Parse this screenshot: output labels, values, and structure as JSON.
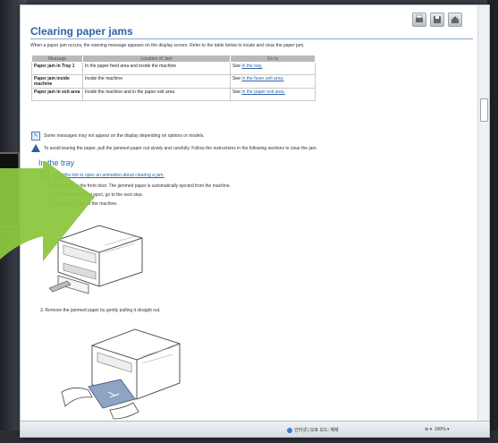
{
  "page": {
    "title": "Clearing paper jams",
    "intro": "When a paper jam occurs, the warning message appears on the display screen. Refer to the table below to locate and clear the paper jam."
  },
  "table": {
    "headers": [
      "Message",
      "Location of Jam",
      "Go to"
    ],
    "rows": [
      {
        "message": "Paper jam in Tray 1",
        "location": "In the paper feed area and inside the machine",
        "goto_prefix": "See",
        "goto_link": "In the tray."
      },
      {
        "message": "Paper jam inside machine",
        "location": "Inside the machine",
        "goto_prefix": "See",
        "goto_link": "In the fuser unit area."
      },
      {
        "message": "Paper jam in exit area",
        "location": "Inside the machine and in the paper exit area",
        "goto_prefix": "See",
        "goto_link": "In the paper exit area."
      }
    ]
  },
  "notes": {
    "note1": "Some messages may not appear on the display depending on options or models.",
    "caution": "To avoid tearing the paper, pull the jammed paper out slowly and carefully. Follow the instructions in the following sections to clear the jam."
  },
  "section": {
    "heading": "In the tray",
    "animation_link": "Click this link to open an animation about clearing a jam.",
    "step1": "Open and close the front door. The jammed paper is automatically ejected from the machine.",
    "step1b": "If the paper does not eject, go to the next step.",
    "step2": "Pull out tray 1 out of the machine.",
    "step3": "3.  Remove the jammed paper by gently pulling it straight out."
  },
  "statusbar": {
    "zone": "인터넷 | 보호 모드: 해제",
    "zoom": "100%"
  },
  "icons": [
    "print-icon",
    "save-icon",
    "home-icon",
    "note-icon",
    "warning-icon",
    "arrow-overlay"
  ],
  "colors": {
    "heading": "#2f64a8",
    "arrow": "#8cc63f"
  }
}
